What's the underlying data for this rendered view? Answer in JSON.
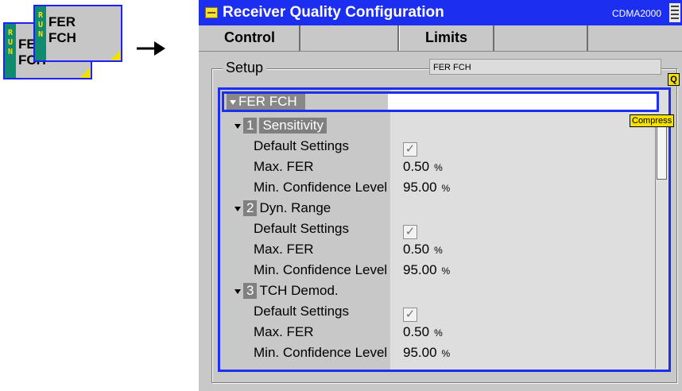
{
  "run_icons": [
    {
      "run_letters": [
        "R",
        "U",
        "N"
      ],
      "line1": "FER",
      "line2": "FCH"
    },
    {
      "run_letters": [
        "R",
        "U",
        "N"
      ],
      "line1": "FER",
      "line2": "FCH"
    }
  ],
  "arrow": "right-arrow-icon",
  "window": {
    "title": "Receiver Quality Configuration",
    "standard": "CDMA2000",
    "tabs": [
      "Control",
      "",
      "Limits",
      "",
      ""
    ],
    "setup_label": "Setup",
    "setup_value": "FER FCH",
    "q_button": "Q",
    "compress_label": "Compress"
  },
  "tree": {
    "root": "FER FCH",
    "groups": [
      {
        "num": "1",
        "name": "Sensitivity",
        "rows": [
          {
            "label": "Default Settings",
            "checked": true
          },
          {
            "label": "Max. FER",
            "value": "0.50",
            "unit": "%"
          },
          {
            "label": "Min. Confidence Level",
            "value": "95.00",
            "unit": "%"
          }
        ]
      },
      {
        "num": "2",
        "name": "Dyn. Range",
        "rows": [
          {
            "label": "Default Settings",
            "checked": true
          },
          {
            "label": "Max. FER",
            "value": "0.50",
            "unit": "%"
          },
          {
            "label": "Min. Confidence Level",
            "value": "95.00",
            "unit": "%"
          }
        ]
      },
      {
        "num": "3",
        "name": "TCH Demod.",
        "rows": [
          {
            "label": "Default Settings",
            "checked": true
          },
          {
            "label": "Max. FER",
            "value": "0.50",
            "unit": "%"
          },
          {
            "label": "Min. Confidence Level",
            "value": "95.00",
            "unit": "%"
          }
        ]
      }
    ],
    "check_mark": "✓"
  },
  "colors": {
    "titlebar": "#1c2ef0",
    "run_bar": "#108a70",
    "accent_yellow": "#f5e000"
  }
}
